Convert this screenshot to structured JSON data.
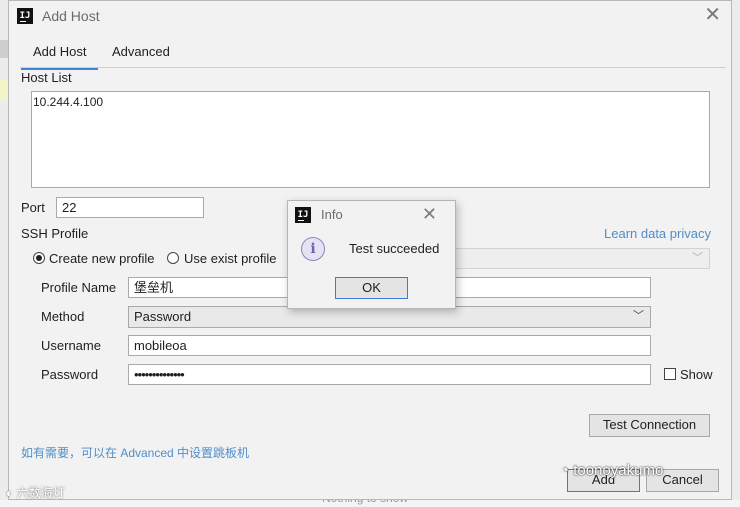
{
  "dialog": {
    "title": "Add Host",
    "tabs": [
      {
        "label": "Add Host",
        "active": true
      },
      {
        "label": "Advanced",
        "active": false
      }
    ],
    "host_list_label": "Host List",
    "host_list_value": "10.244.4.100",
    "port_label": "Port",
    "port_value": "22",
    "ssh_profile_label": "SSH Profile",
    "learn_link": "Learn data privacy",
    "radio_create": "Create new profile",
    "radio_use_exist": "Use exist profile",
    "profile_name_label": "Profile Name",
    "profile_name_value": "堡垒机",
    "method_label": "Method",
    "method_value": "Password",
    "username_label": "Username",
    "username_value": "mobileoa",
    "password_label": "Password",
    "password_value": "••••••••••••••",
    "show_label": "Show",
    "test_connection": "Test Connection",
    "note": "如有需要，可以在 Advanced 中设置跳板机",
    "add_button": "Add",
    "cancel_button": "Cancel"
  },
  "info_popup": {
    "title": "Info",
    "message": "Test succeeded",
    "ok": "OK"
  },
  "background": {
    "bottom_text": "Nothing to show"
  },
  "watermarks": {
    "main": "toonoyakumo",
    "small": "六数海灯"
  },
  "colors": {
    "accent": "#3d83d6",
    "link": "#4f8ecb",
    "info_icon": "#6d66ad"
  }
}
